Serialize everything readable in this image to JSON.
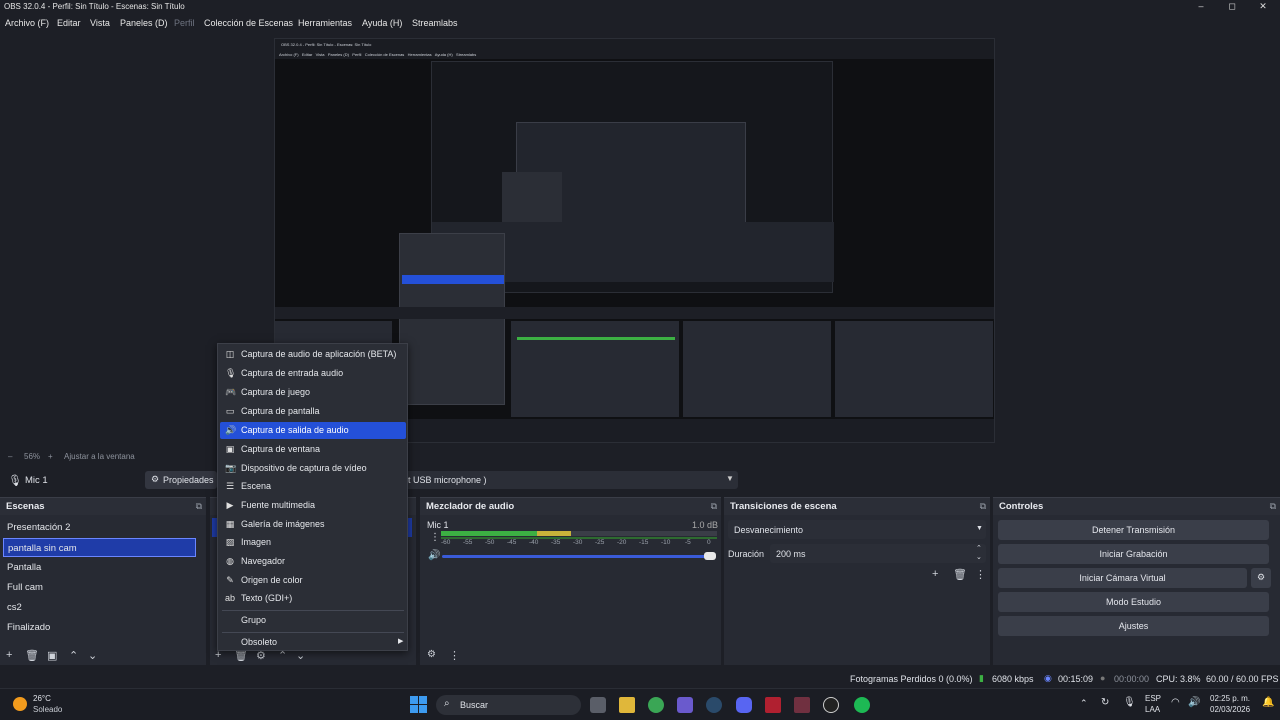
{
  "window": {
    "title": "OBS 32.0.4 - Perfil: Sin Título - Escenas: Sin Título",
    "minimize": "–",
    "maximize": "◻",
    "close": "✕"
  },
  "menu": [
    "Archivo (F)",
    "Editar",
    "Vista",
    "Paneles (D)",
    "Perfil",
    "Colección de Escenas",
    "Herramientas",
    "Ayuda (H)",
    "Streamlabs"
  ],
  "zoom": {
    "value": "56%",
    "fit": "Ajustar a la ventana"
  },
  "sourcebar": {
    "source": "Mic 1",
    "properties": "Propiedades",
    "device": "t USB microphone )"
  },
  "scenes": {
    "title": "Escenas",
    "items": [
      "Presentación 2",
      "pantalla sin cam",
      "Pantalla",
      "Full cam",
      "cs2",
      "Finalizado"
    ],
    "selected": 1
  },
  "mixer": {
    "title": "Mezclador de audio",
    "channel": "Mic 1",
    "db": "1.0 dB",
    "ticks": [
      "-60",
      "-55",
      "-50",
      "-45",
      "-40",
      "-35",
      "-30",
      "-25",
      "-20",
      "-15",
      "-10",
      "-5",
      "0"
    ]
  },
  "transitions": {
    "title": "Transiciones de escena",
    "type": "Desvanecimiento",
    "duration_label": "Duración",
    "duration": "200 ms"
  },
  "controls": {
    "title": "Controles",
    "buttons": [
      "Detener Transmisión",
      "Iniciar Grabación",
      "Iniciar Cámara Virtual",
      "Modo Estudio",
      "Ajustes"
    ]
  },
  "context_menu": {
    "items": [
      {
        "label": "Captura de audio de aplicación (BETA)",
        "icon": "speaker-icon"
      },
      {
        "label": "Captura de entrada audio",
        "icon": "microphone-icon"
      },
      {
        "label": "Captura de juego",
        "icon": "gamepad-icon"
      },
      {
        "label": "Captura de pantalla",
        "icon": "monitor-icon"
      },
      {
        "label": "Captura de salida de audio",
        "icon": "volume-icon"
      },
      {
        "label": "Captura de ventana",
        "icon": "window-icon"
      },
      {
        "label": "Dispositivo de captura de vídeo",
        "icon": "camera-icon"
      },
      {
        "label": "Escena",
        "icon": "list-icon"
      },
      {
        "label": "Fuente multimedia",
        "icon": "play-icon"
      },
      {
        "label": "Galería de imágenes",
        "icon": "images-icon"
      },
      {
        "label": "Imagen",
        "icon": "image-icon"
      },
      {
        "label": "Navegador",
        "icon": "globe-icon"
      },
      {
        "label": "Origen de color",
        "icon": "brush-icon"
      },
      {
        "label": "Texto (GDI+)",
        "icon": "text-icon"
      }
    ],
    "group": "Grupo",
    "obsolete": "Obsoleto",
    "selected": 4
  },
  "status": {
    "dropped": "Fotogramas Perdidos 0 (0.0%)",
    "bitrate": "6080 kbps",
    "stream_time": "00:15:09",
    "rec_time": "00:00:00",
    "cpu": "CPU: 3.8%",
    "fps": "60.00 / 60.00 FPS"
  },
  "taskbar": {
    "temp": "26°C",
    "weather": "Soleado",
    "search": "Buscar",
    "lang1": "ESP",
    "lang2": "LAA",
    "time": "02:25 p. m.",
    "date": "02/03/2026"
  },
  "nested": {
    "title": "OBS 32.0.4 - Perfil: Sin Título - Escenas: Sin Título",
    "menu": "Archivo (F)   Editar   Vista   Paneles (D)   Perfil   Colección de Escenas   Herramientas   Ayuda (H)   Streamlabs"
  },
  "colors": {
    "accent": "#2450d8",
    "selected_scene": "#1f3ca8",
    "meter_green": "#3cb043",
    "meter_yellow": "#c8b23a",
    "meter_red": "#b03a3a"
  }
}
